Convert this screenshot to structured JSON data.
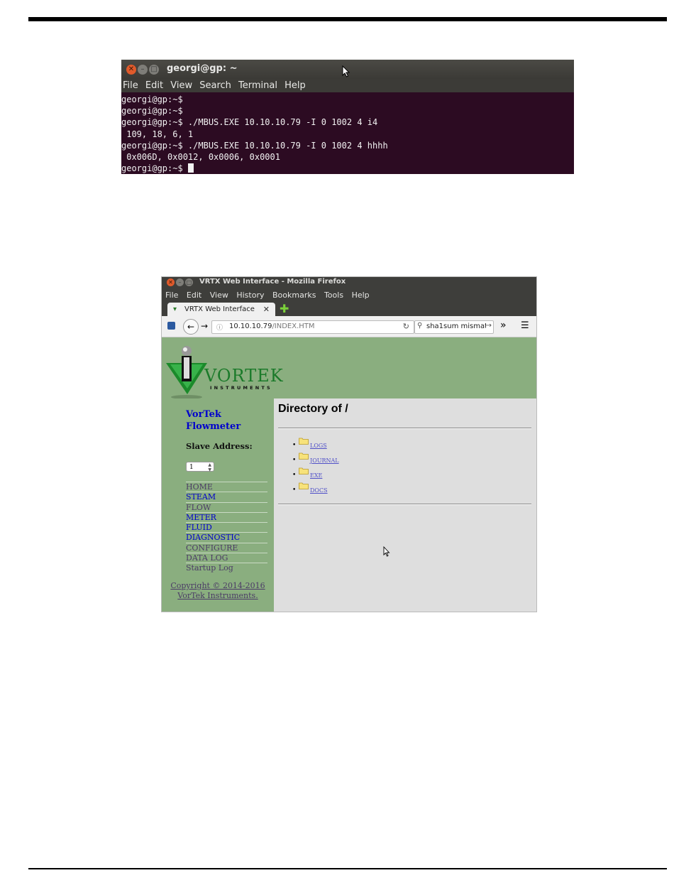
{
  "terminal": {
    "title": "georgi@gp: ~",
    "menu": [
      "File",
      "Edit",
      "View",
      "Search",
      "Terminal",
      "Help"
    ],
    "lines": [
      "georgi@gp:~$",
      "georgi@gp:~$",
      "georgi@gp:~$ ./MBUS.EXE 10.10.10.79 -I 0 1002 4 i4",
      " 109, 18, 6, 1",
      "georgi@gp:~$ ./MBUS.EXE 10.10.10.79 -I 0 1002 4 hhhh",
      " 0x006D, 0x0012, 0x0006, 0x0001"
    ],
    "prompt": "georgi@gp:~$ "
  },
  "browser": {
    "window_title": "VRTX Web Interface - Mozilla Firefox",
    "menu": [
      "File",
      "Edit",
      "View",
      "History",
      "Bookmarks",
      "Tools",
      "Help"
    ],
    "tab_label": "VRTX Web Interface",
    "url_host": "10.10.10.79",
    "url_path": "/INDEX.HTM",
    "search_value": "sha1sum mismat",
    "overflow_label": "»"
  },
  "site": {
    "logo_word": "VORTEK",
    "logo_sub": "INSTRUMENTS",
    "side_title_1": "VorTek",
    "side_title_2": "Flowmeter",
    "slave_label": "Slave Address:",
    "slave_value": "1",
    "nav": [
      {
        "label": "HOME",
        "color": "#4b3b66"
      },
      {
        "label": "STEAM",
        "color": "#0000cc"
      },
      {
        "label": "FLOW",
        "color": "#4b3b66"
      },
      {
        "label": "METER",
        "color": "#0000cc"
      },
      {
        "label": "FLUID",
        "color": "#0000cc"
      },
      {
        "label": "DIAGNOSTIC",
        "color": "#0000cc"
      },
      {
        "label": "CONFIGURE",
        "color": "#4b3b66"
      },
      {
        "label": "DATA LOG",
        "color": "#4b3b66"
      },
      {
        "label": "Startup Log",
        "color": "#4b3b66"
      }
    ],
    "copyright_1": "Copyright © 2014-2016",
    "copyright_2": "VorTek Instruments.",
    "dir_title": "Directory of /",
    "entries": [
      "LOGS",
      "JOURNAL",
      "EXE",
      "DOCS"
    ]
  },
  "colors": {
    "terminal_bg": "#2c0b22",
    "site_green": "#8aae7f",
    "content_bg": "#dedede",
    "link_blue": "#0000cc"
  }
}
